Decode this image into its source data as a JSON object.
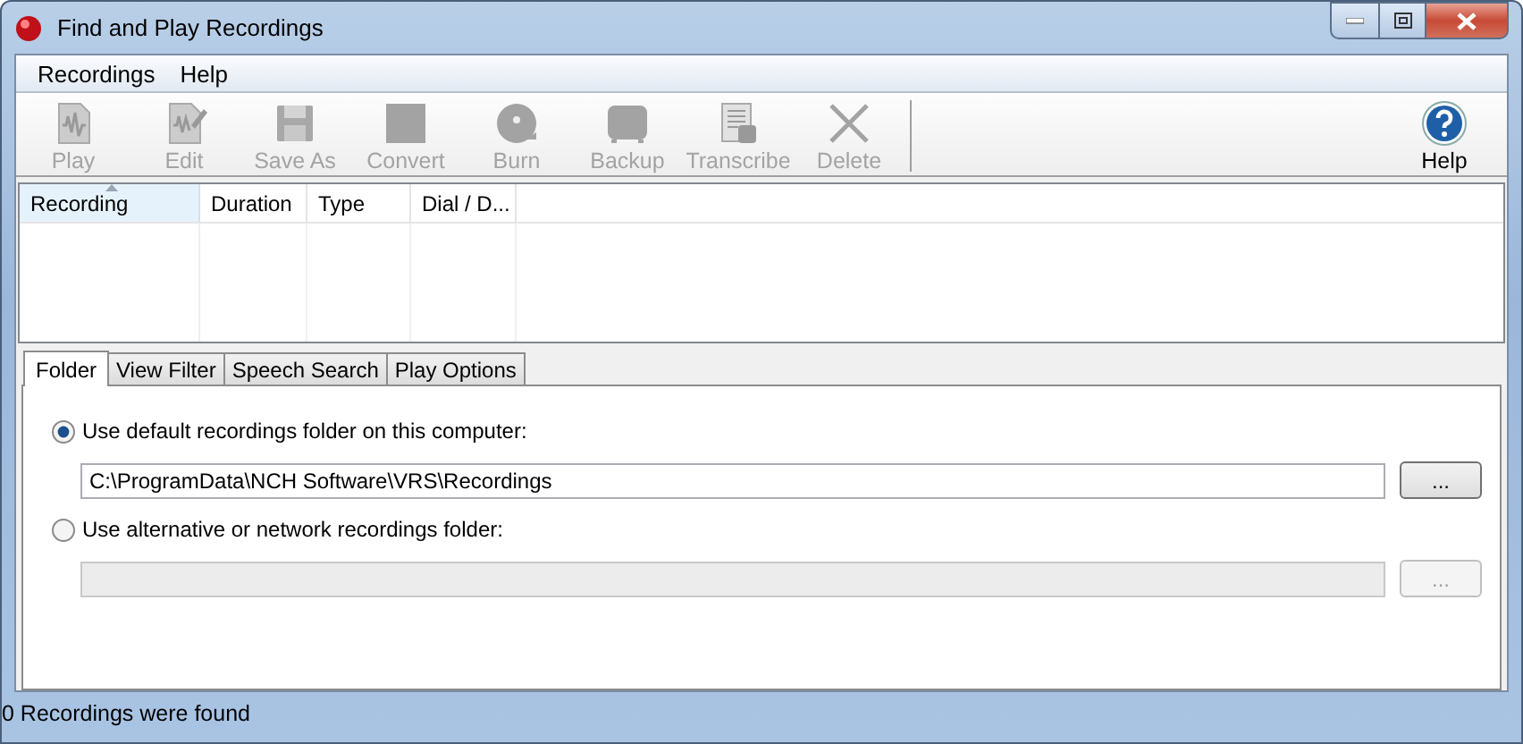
{
  "window": {
    "title": "Find and Play Recordings"
  },
  "menu": [
    "Recordings",
    "Help"
  ],
  "toolbar": [
    {
      "label": "Play",
      "kind": "play",
      "disabled": true
    },
    {
      "label": "Edit",
      "kind": "edit",
      "disabled": true
    },
    {
      "label": "Save As",
      "kind": "save",
      "disabled": true
    },
    {
      "label": "Convert",
      "kind": "convert",
      "disabled": true
    },
    {
      "label": "Burn",
      "kind": "burn",
      "disabled": true
    },
    {
      "label": "Backup",
      "kind": "backup",
      "disabled": true
    },
    {
      "label": "Transcribe",
      "kind": "transcribe",
      "disabled": true
    },
    {
      "label": "Delete",
      "kind": "delete",
      "disabled": true
    }
  ],
  "help_button": {
    "label": "Help",
    "disabled": false
  },
  "table": {
    "columns": [
      {
        "label": "Recording",
        "sorted": true
      },
      {
        "label": "Duration",
        "sorted": false
      },
      {
        "label": "Type",
        "sorted": false
      },
      {
        "label": "Dial / D...",
        "sorted": false
      }
    ]
  },
  "tabs": [
    {
      "label": "Folder",
      "selected": true
    },
    {
      "label": "View Filter",
      "selected": false
    },
    {
      "label": "Speech Search",
      "selected": false
    },
    {
      "label": "Play Options",
      "selected": false
    }
  ],
  "folder_options": [
    {
      "label": "Use default recordings folder on this computer:",
      "selected": true,
      "path": "C:\\ProgramData\\NCH Software\\VRS\\Recordings",
      "disabled": false,
      "browse_label": "..."
    },
    {
      "label": "Use alternative or network recordings folder:",
      "selected": false,
      "disabled": true,
      "browse_label": "..."
    }
  ],
  "status_bar": "0 Recordings were found"
}
